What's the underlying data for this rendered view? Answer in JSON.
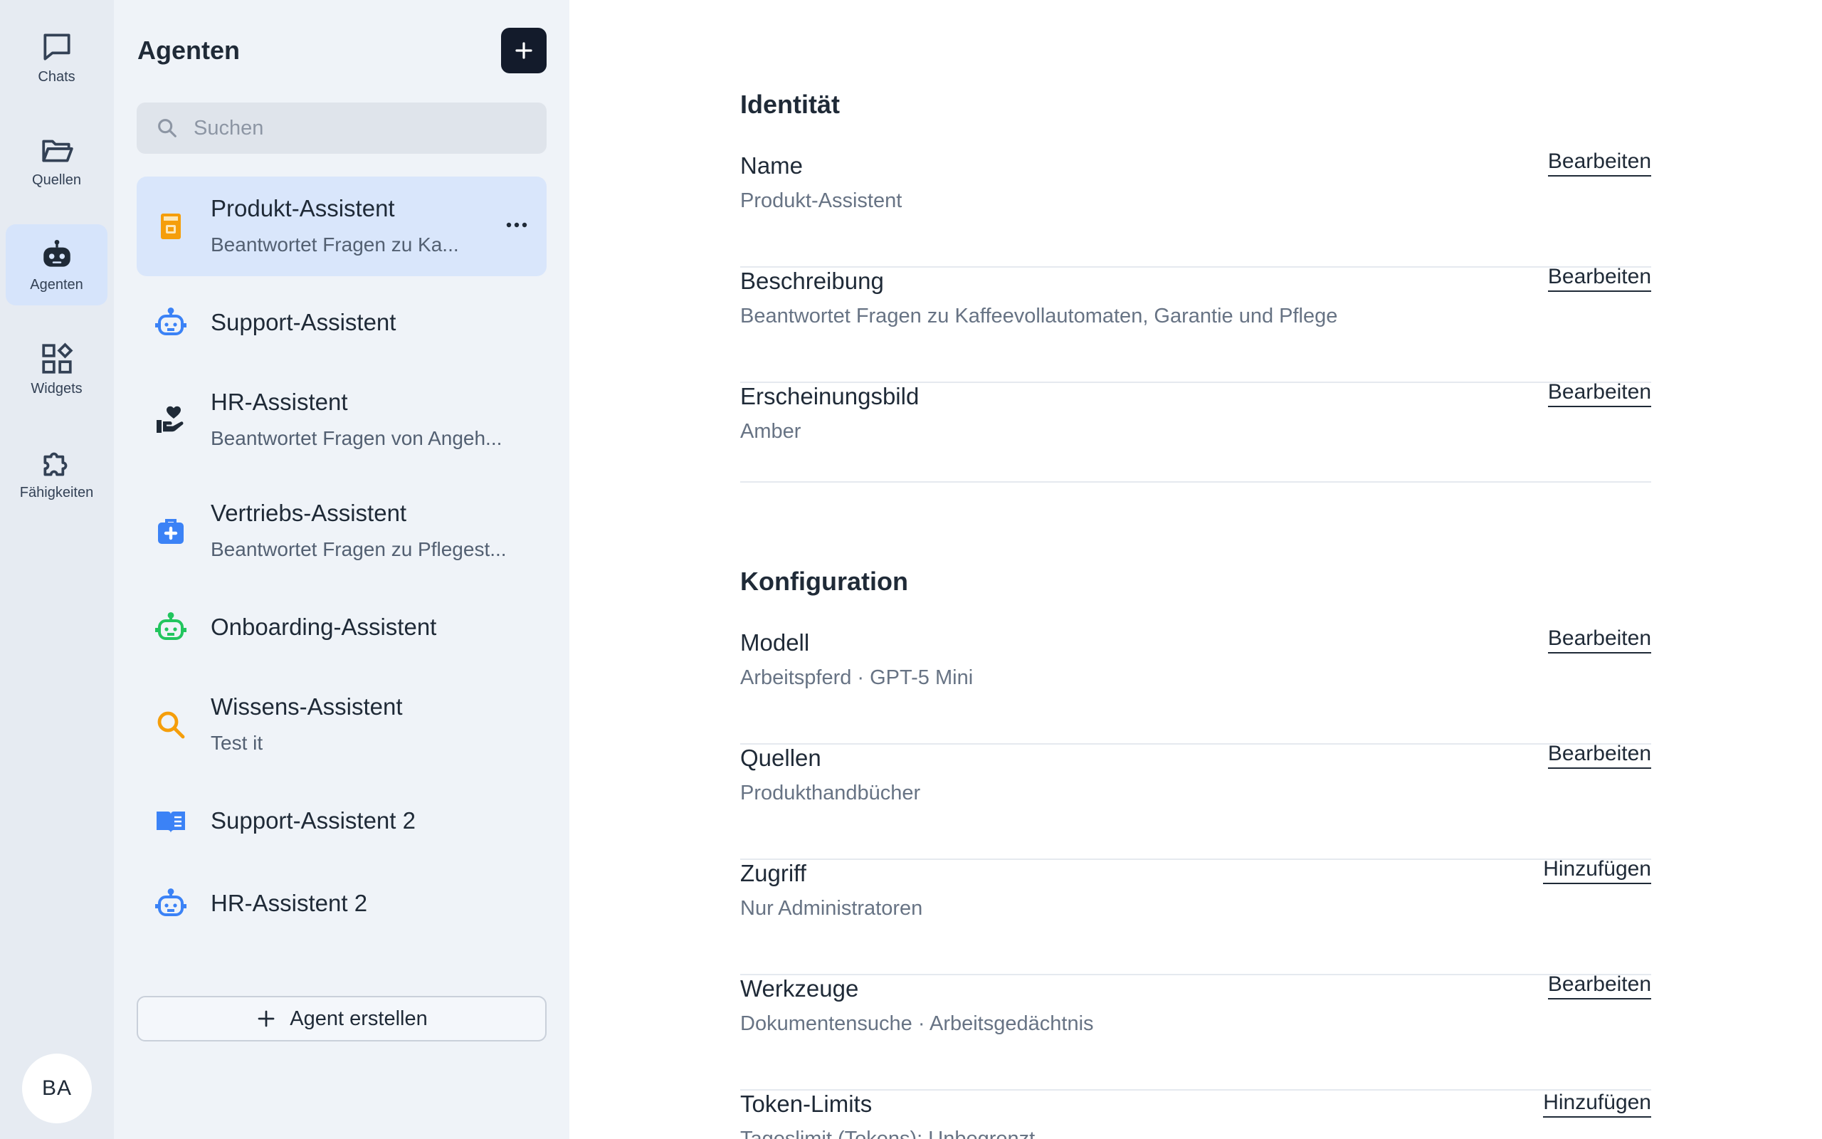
{
  "rail": {
    "items": [
      {
        "label": "Chats",
        "icon": "chat-icon"
      },
      {
        "label": "Quellen",
        "icon": "folder-icon"
      },
      {
        "label": "Agenten",
        "icon": "robot-icon",
        "active": true
      },
      {
        "label": "Widgets",
        "icon": "widgets-icon"
      },
      {
        "label": "Fähigkeiten",
        "icon": "puzzle-icon"
      }
    ],
    "avatar_initials": "BA"
  },
  "list": {
    "title": "Agenten",
    "search_placeholder": "Suchen",
    "agents": [
      {
        "name": "Produkt-Assistent",
        "desc": "Beantwortet Fragen zu Ka...",
        "icon": "coffee-machine-icon",
        "color": "#f59e0b",
        "selected": true
      },
      {
        "name": "Support-Assistent",
        "desc": "",
        "icon": "robot-icon",
        "color": "#3b82f6"
      },
      {
        "name": "HR-Assistent",
        "desc": "Beantwortet Fragen von Angeh...",
        "icon": "hand-heart-icon",
        "color": "#1f2a37"
      },
      {
        "name": "Vertriebs-Assistent",
        "desc": "Beantwortet Fragen zu Pflegest...",
        "icon": "medical-bag-icon",
        "color": "#3b82f6"
      },
      {
        "name": "Onboarding-Assistent",
        "desc": "",
        "icon": "robot-icon",
        "color": "#22c55e"
      },
      {
        "name": "Wissens-Assistent",
        "desc": "Test it",
        "icon": "search-icon",
        "color": "#f59e0b"
      },
      {
        "name": "Support-Assistent 2",
        "desc": "",
        "icon": "book-open-icon",
        "color": "#3b82f6"
      },
      {
        "name": "HR-Assistent 2",
        "desc": "",
        "icon": "robot-icon",
        "color": "#3b82f6"
      }
    ],
    "create_label": "Agent erstellen"
  },
  "main": {
    "identity": {
      "title": "Identität",
      "rows": [
        {
          "label": "Name",
          "value": "Produkt-Assistent",
          "action": "Bearbeiten"
        },
        {
          "label": "Beschreibung",
          "value": "Beantwortet Fragen zu Kaffeevollautomaten, Garantie und Pflege",
          "action": "Bearbeiten"
        },
        {
          "label": "Erscheinungsbild",
          "value": "Amber",
          "action": "Bearbeiten"
        }
      ]
    },
    "config": {
      "title": "Konfiguration",
      "rows": [
        {
          "label": "Modell",
          "value": "Arbeitspferd · GPT-5 Mini",
          "action": "Bearbeiten"
        },
        {
          "label": "Quellen",
          "value": "Produkthandbücher",
          "action": "Bearbeiten"
        },
        {
          "label": "Zugriff",
          "value": "Nur Administratoren",
          "action": "Hinzufügen"
        },
        {
          "label": "Werkzeuge",
          "value": "Dokumentensuche · Arbeitsgedächtnis",
          "action": "Bearbeiten"
        },
        {
          "label": "Token-Limits",
          "value": "Tageslimit (Tokens): Unbegrenzt",
          "action": "Hinzufügen"
        }
      ]
    }
  }
}
